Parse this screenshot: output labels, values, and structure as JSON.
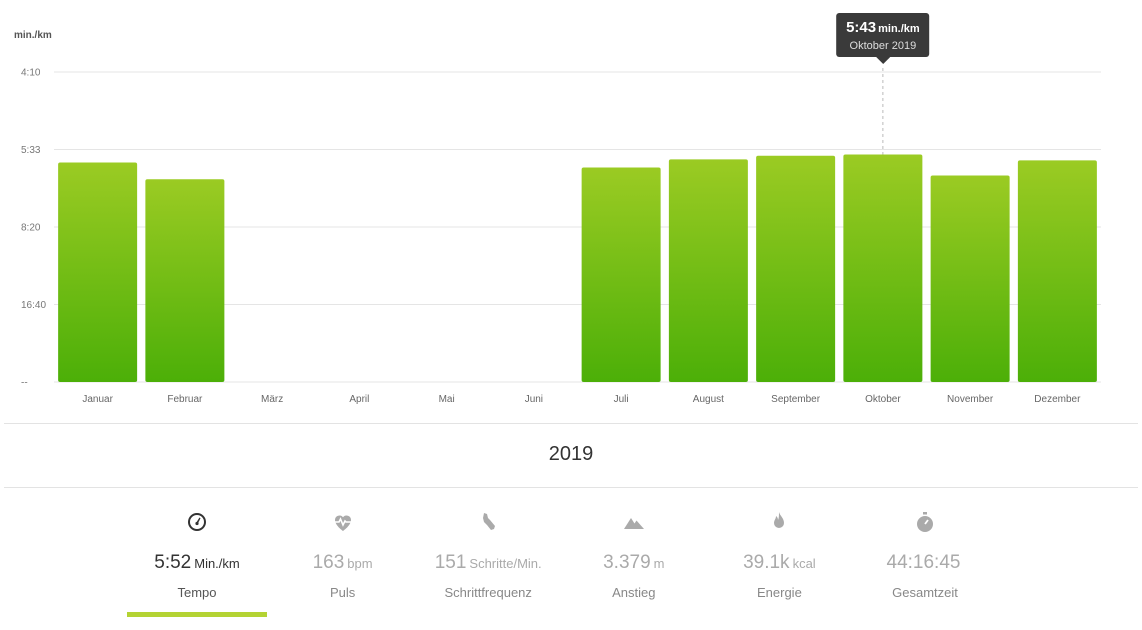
{
  "colors": {
    "bar_top": "#9bcb23",
    "bar_bottom": "#4caf08",
    "grid": "#e5e5e5",
    "tooltip_bg": "#3a3a3a",
    "active_underline": "#b4d333"
  },
  "chart_data": {
    "type": "bar",
    "y_unit_label": "min./km",
    "y_ticks": [
      "4:10",
      "5:33",
      "8:20",
      "16:40",
      "--"
    ],
    "categories": [
      "Januar",
      "Februar",
      "März",
      "April",
      "Mai",
      "Juni",
      "Juli",
      "August",
      "September",
      "Oktober",
      "November",
      "Dezember"
    ],
    "values": [
      0.708,
      0.654,
      null,
      null,
      null,
      null,
      0.692,
      0.718,
      0.73,
      0.734,
      0.666,
      0.715
    ],
    "value_scale": "fraction of full axis height (top gridline = 1)",
    "grid": true,
    "highlighted_category": "Oktober"
  },
  "tooltip": {
    "value": "5:43",
    "unit": "min./km",
    "subtitle": "Oktober 2019"
  },
  "period": {
    "year": "2019"
  },
  "stats": [
    {
      "name": "tempo",
      "icon": "speedometer-icon",
      "value": "5:52",
      "unit": "Min./km",
      "label": "Tempo",
      "active": true
    },
    {
      "name": "puls",
      "icon": "heart-rate-icon",
      "value": "163",
      "unit": "bpm",
      "label": "Puls",
      "active": false
    },
    {
      "name": "schrittfrequenz",
      "icon": "shoe-icon",
      "value": "151",
      "unit": "Schritte/Min.",
      "label": "Schrittfrequenz",
      "active": false
    },
    {
      "name": "anstieg",
      "icon": "mountain-icon",
      "value": "3.379",
      "unit": "m",
      "label": "Anstieg",
      "active": false
    },
    {
      "name": "energie",
      "icon": "flame-icon",
      "value": "39.1k",
      "unit": "kcal",
      "label": "Energie",
      "active": false
    },
    {
      "name": "gesamtzeit",
      "icon": "stopwatch-icon",
      "value": "44:16:45",
      "unit": "",
      "label": "Gesamtzeit",
      "active": false
    }
  ]
}
